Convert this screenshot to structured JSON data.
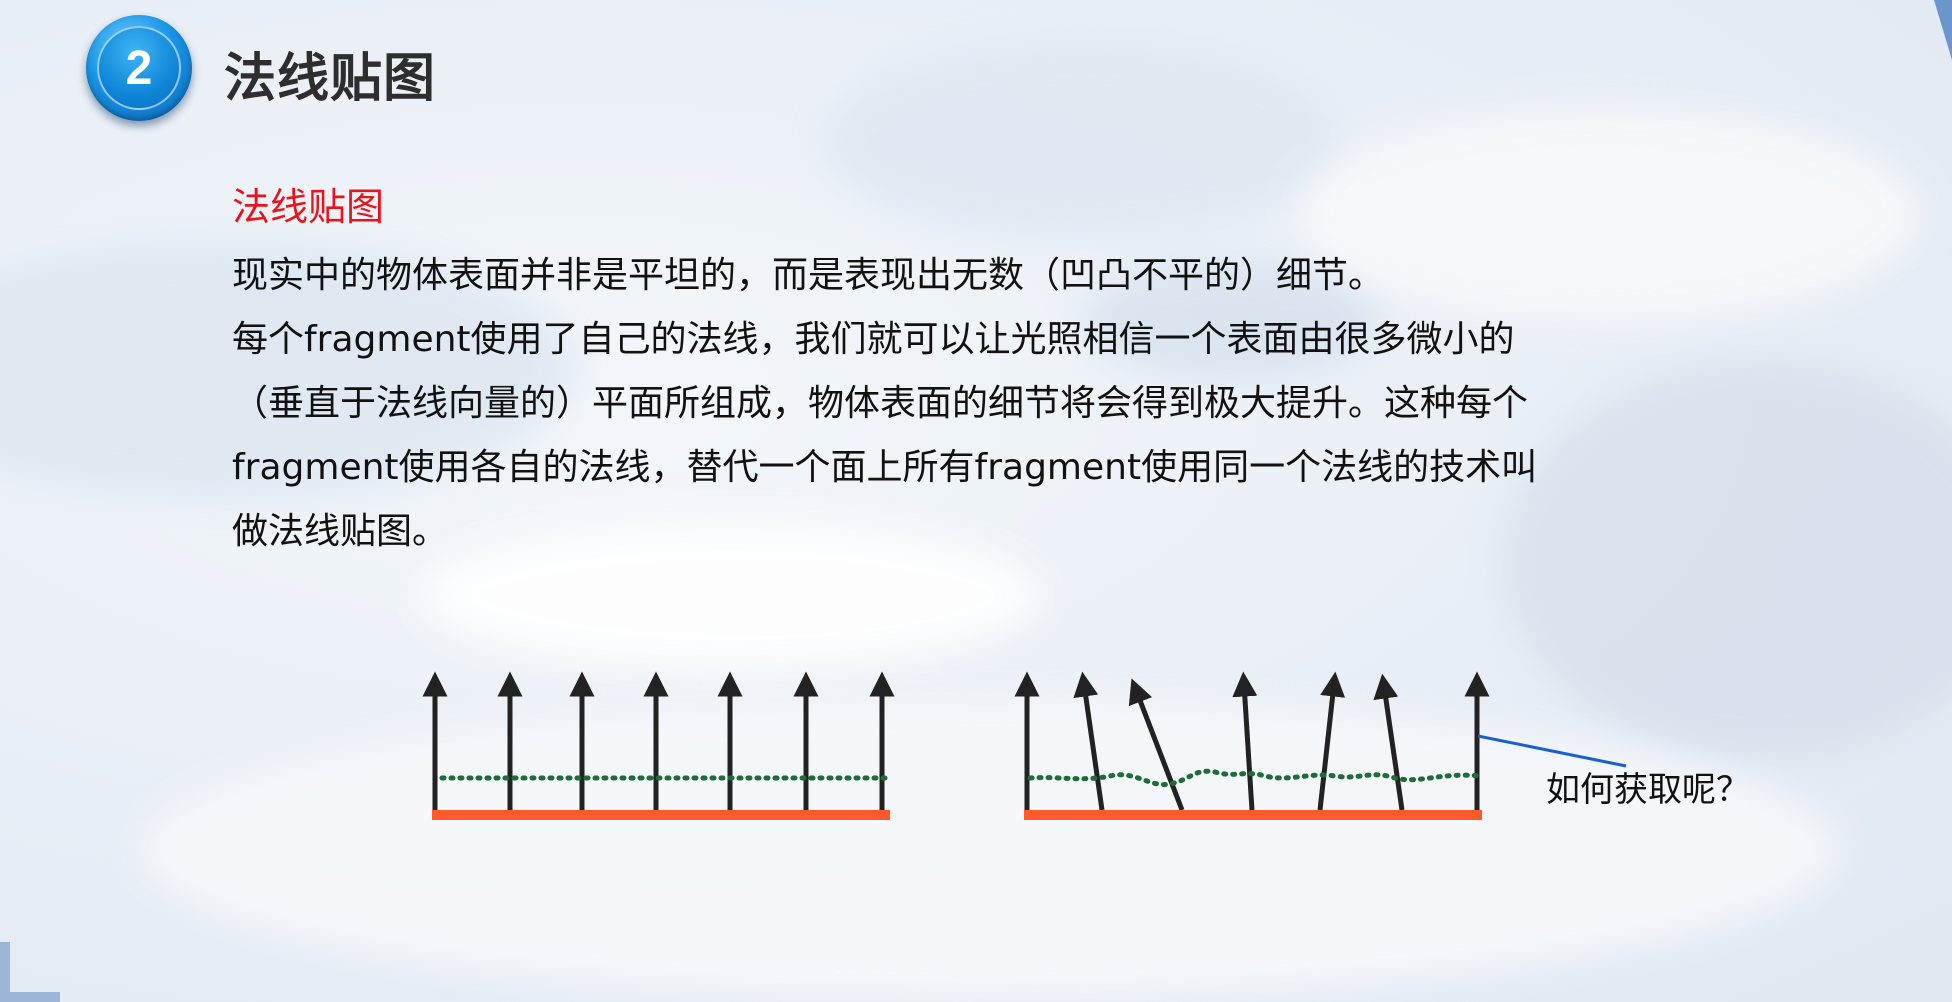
{
  "section": {
    "number": "2",
    "title": "法线贴图"
  },
  "subtitle": "法线贴图",
  "paragraph": {
    "lines": [
      "现实中的物体表面并非是平坦的，而是表现出无数（凹凸不平的）细节。",
      "每个fragment使用了自己的法线，我们就可以让光照相信一个表面由很多微小的",
      "（垂直于法线向量的）平面所组成，物体表面的细节将会得到极大提升。这种每个",
      "fragment使用各自的法线，替代一个面上所有fragment使用同一个法线的技术叫",
      "做法线贴图。"
    ]
  },
  "diagram": {
    "callout": "如何获取呢？",
    "colors": {
      "surface": "#ff5a2e",
      "normals": "#222222",
      "dotted_line": "#1f6b3a",
      "callout_line": "#1a5fd0",
      "title_badge": "#1796e6",
      "subtitle": "#e8141c"
    }
  }
}
